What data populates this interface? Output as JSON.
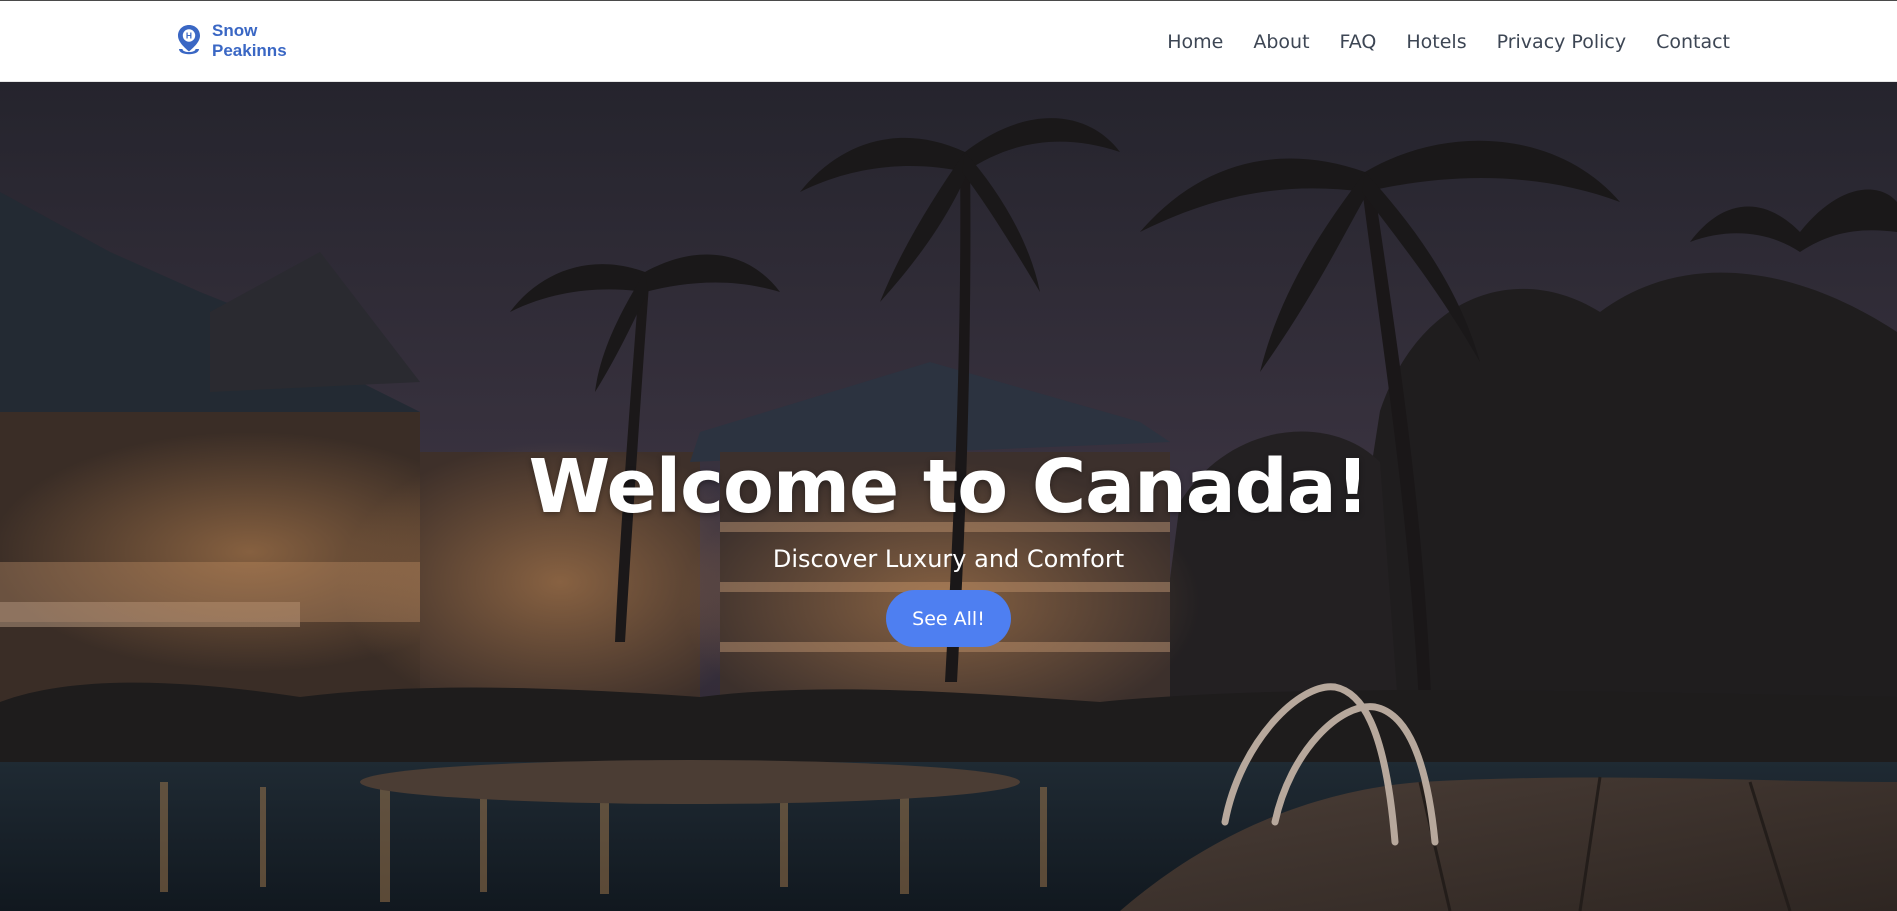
{
  "brand": {
    "line1": "Snow",
    "line2": "Peakinns",
    "icon": "hotel-location-pin-icon",
    "color": "#3a67c4"
  },
  "nav": {
    "items": [
      {
        "label": "Home"
      },
      {
        "label": "About"
      },
      {
        "label": "FAQ"
      },
      {
        "label": "Hotels"
      },
      {
        "label": "Privacy Policy"
      },
      {
        "label": "Contact"
      }
    ]
  },
  "hero": {
    "title": "Welcome to Canada!",
    "subtitle": "Discover Luxury and Comfort",
    "button_label": "See All!",
    "button_color": "#4e7ff1",
    "background": "night-resort-pool-palm-trees-photo"
  }
}
